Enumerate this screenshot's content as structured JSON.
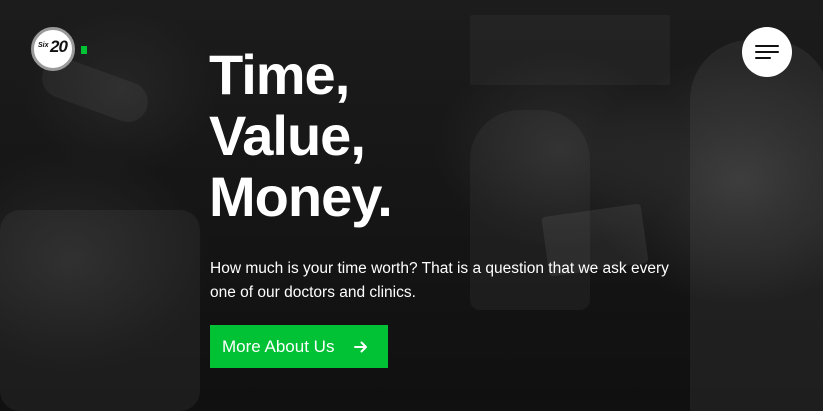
{
  "logo": {
    "prefix": "Six",
    "number": "20",
    "accent_color": "#00c234"
  },
  "menu": {
    "icon": "hamburger-menu-icon"
  },
  "hero": {
    "headline": [
      "Time,",
      "Value,",
      "Money."
    ],
    "subtext": "How much is your time worth? That is a question that we ask every one of our doctors and clinics.",
    "cta_label": "More About Us",
    "cta_icon": "arrow-right-icon",
    "cta_color": "#00c234"
  }
}
